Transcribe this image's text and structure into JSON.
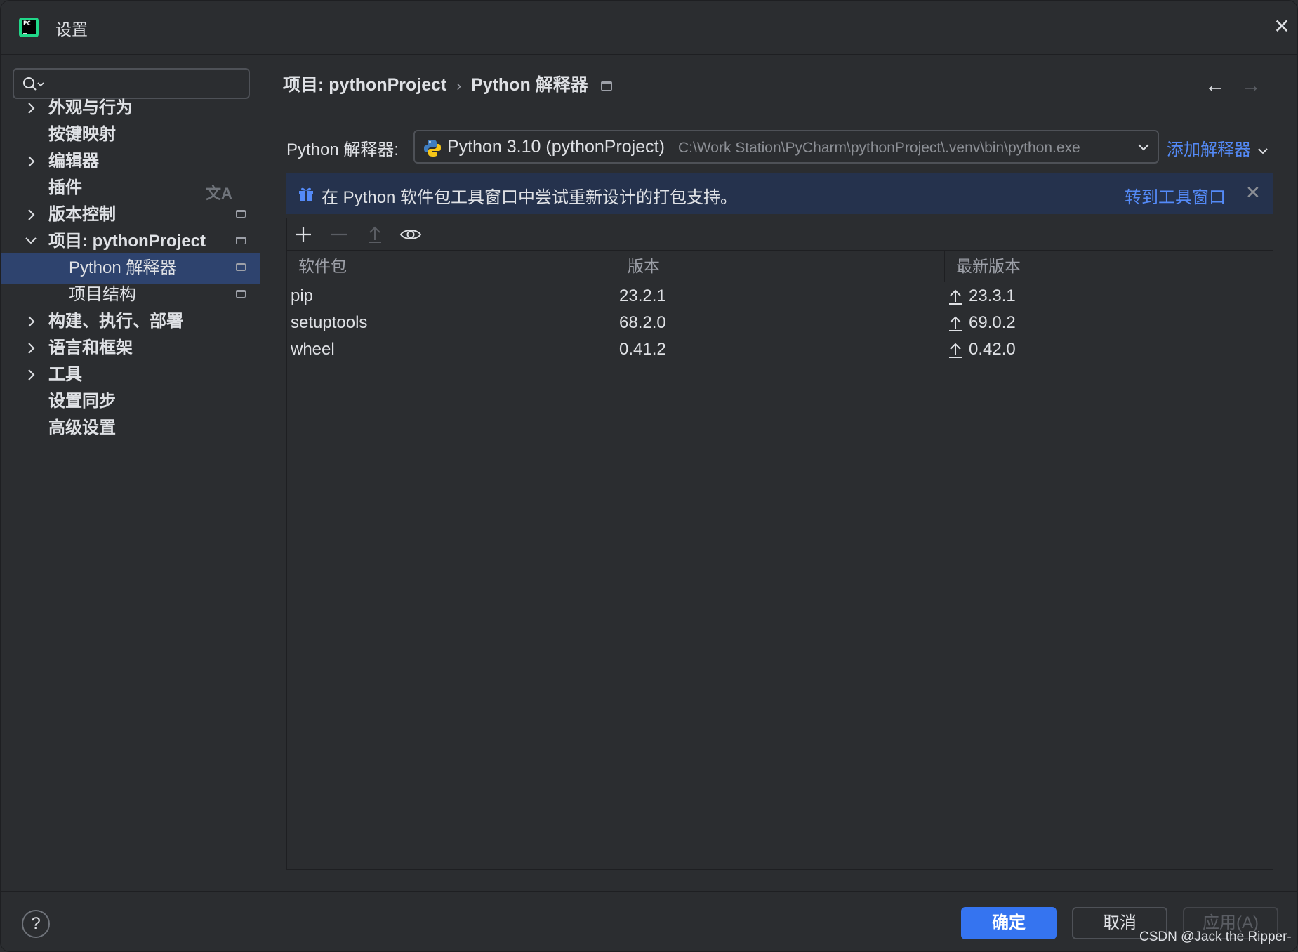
{
  "window": {
    "title": "设置",
    "close_glyph": "✕"
  },
  "sidebar": {
    "items": [
      {
        "label": "外观与行为",
        "expandable": true,
        "expanded": false
      },
      {
        "label": "按键映射",
        "expandable": false
      },
      {
        "label": "编辑器",
        "expandable": true,
        "expanded": false
      },
      {
        "label": "插件",
        "expandable": false,
        "icon": "translate-icon"
      },
      {
        "label": "版本控制",
        "expandable": true,
        "expanded": false,
        "icon": "dock-icon"
      },
      {
        "label": "项目: pythonProject",
        "expandable": true,
        "expanded": true,
        "icon": "dock-icon"
      },
      {
        "label": "Python 解释器",
        "child": true,
        "selected": true,
        "icon": "dock-icon"
      },
      {
        "label": "项目结构",
        "child": true,
        "icon": "dock-icon"
      },
      {
        "label": "构建、执行、部署",
        "expandable": true,
        "expanded": false
      },
      {
        "label": "语言和框架",
        "expandable": true,
        "expanded": false
      },
      {
        "label": "工具",
        "expandable": true,
        "expanded": false
      },
      {
        "label": "设置同步",
        "expandable": false
      },
      {
        "label": "高级设置",
        "expandable": false
      }
    ],
    "translate_glyph": "文A"
  },
  "breadcrumb": {
    "parent": "项目: pythonProject",
    "separator": "›",
    "current": "Python 解释器"
  },
  "nav": {
    "back": "←",
    "forward": "→"
  },
  "interpreter": {
    "label": "Python 解释器:",
    "name": "Python 3.10 (pythonProject)",
    "path": "C:\\Work Station\\PyCharm\\pythonProject\\.venv\\bin\\python.exe",
    "add_label": "添加解释器"
  },
  "banner": {
    "text": "在 Python 软件包工具窗口中尝试重新设计的打包支持。",
    "link": "转到工具窗口",
    "close": "✕"
  },
  "packages": {
    "columns": [
      "软件包",
      "版本",
      "最新版本"
    ],
    "rows": [
      {
        "name": "pip",
        "version": "23.2.1",
        "latest": "23.3.1"
      },
      {
        "name": "setuptools",
        "version": "68.2.0",
        "latest": "69.0.2"
      },
      {
        "name": "wheel",
        "version": "0.41.2",
        "latest": "0.42.0"
      }
    ]
  },
  "footer": {
    "help": "?",
    "ok": "确定",
    "cancel": "取消",
    "apply": "应用(A)",
    "watermark": "CSDN @Jack the Ripper-"
  },
  "colors": {
    "background": "#2b2d30",
    "selection": "#2e436e",
    "accent": "#3574f0",
    "link": "#548af7",
    "banner": "#25324d"
  }
}
